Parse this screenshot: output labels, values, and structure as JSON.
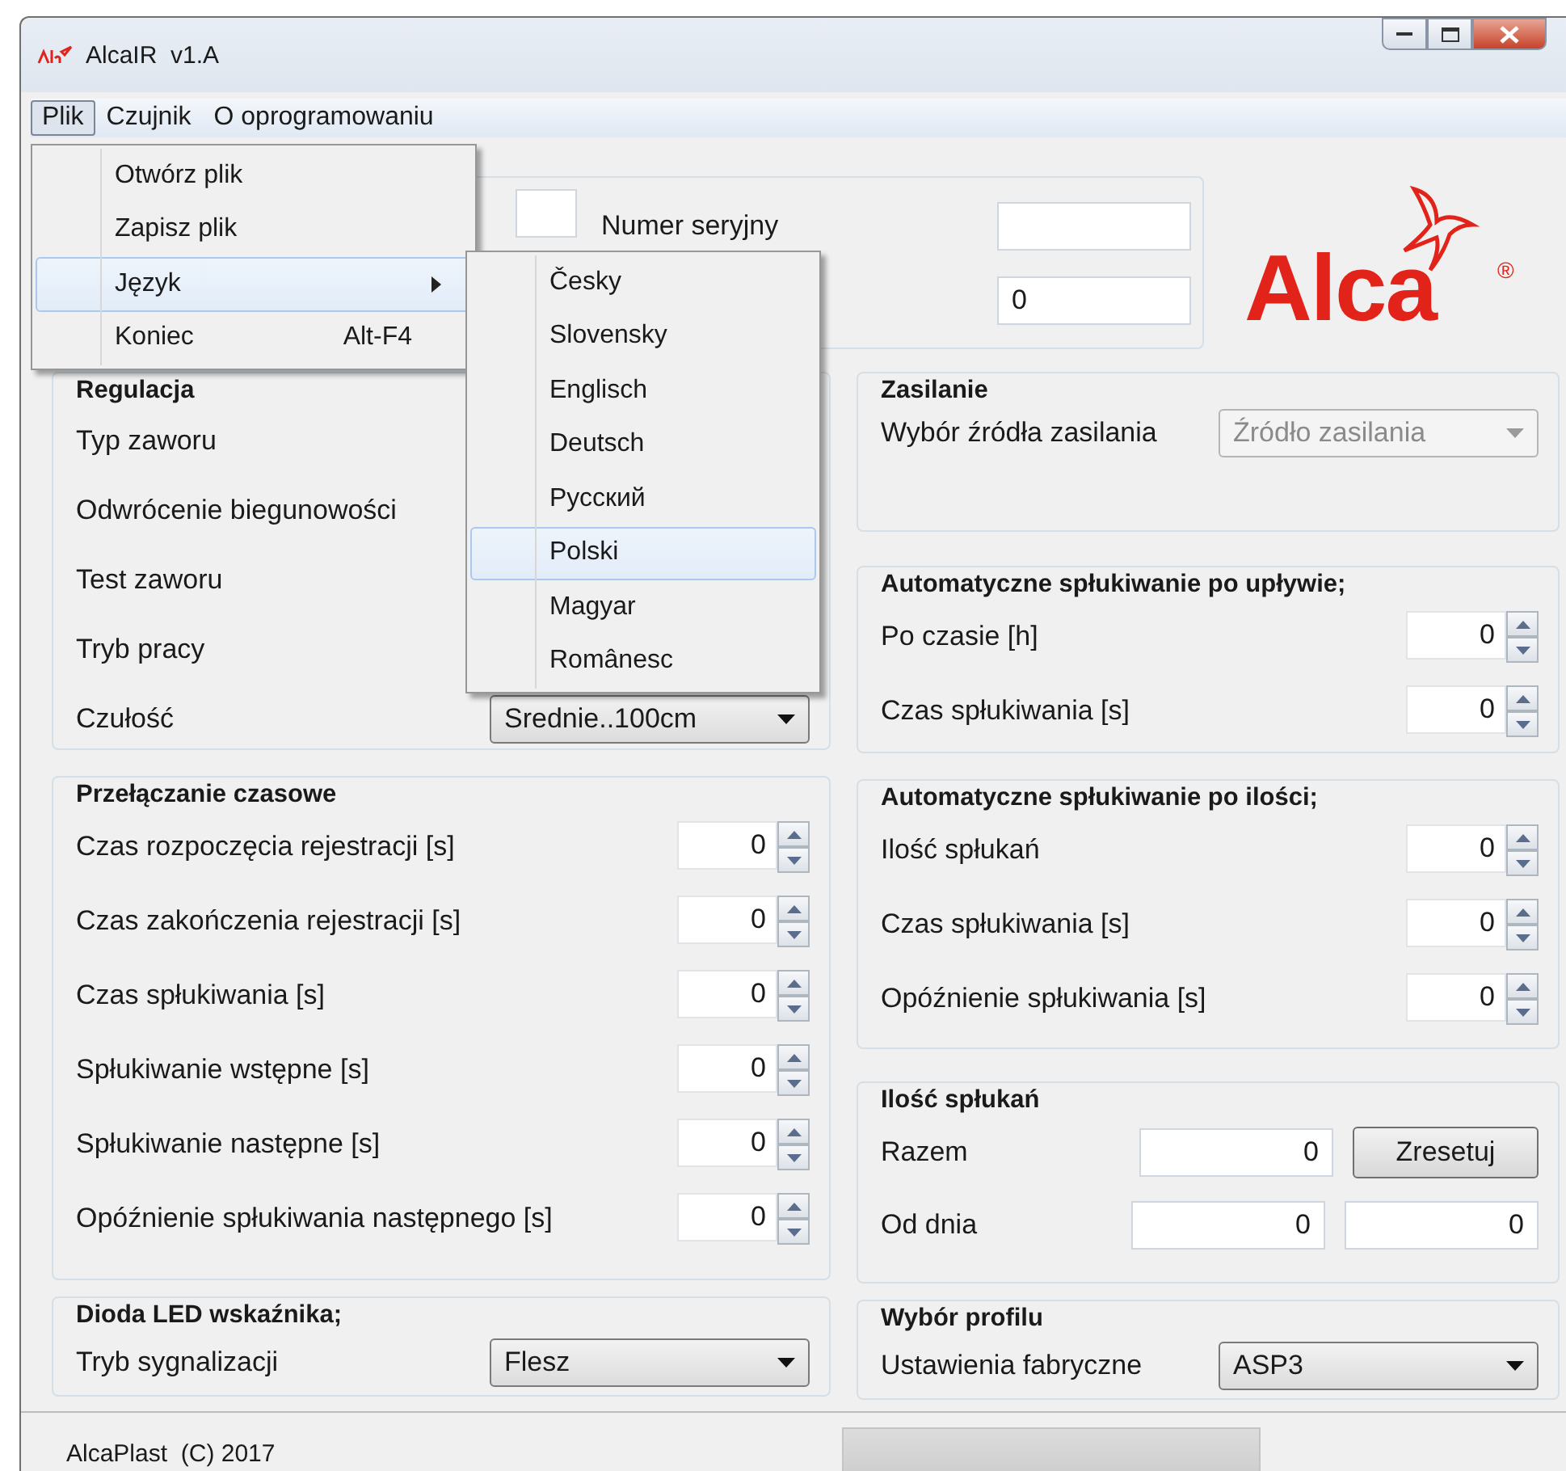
{
  "window": {
    "title": "AlcaIR  v1.A"
  },
  "menu_bar": [
    {
      "label": "Plik",
      "selected": true
    },
    {
      "label": "Czujnik",
      "selected": false
    },
    {
      "label": "O oprogramowaniu",
      "selected": false
    }
  ],
  "file_menu": [
    {
      "label": "Otwórz plik",
      "selected": false
    },
    {
      "label": "Zapisz plik",
      "selected": false
    },
    {
      "label": "Język",
      "submenu": true,
      "selected": true
    },
    {
      "label": "Koniec",
      "shortcut": "Alt-F4",
      "selected": false
    }
  ],
  "language_menu": [
    {
      "label": "Česky",
      "selected": false
    },
    {
      "label": "Slovensky",
      "selected": false
    },
    {
      "label": "Englisch",
      "selected": false
    },
    {
      "label": "Deutsch",
      "selected": false
    },
    {
      "label": "Русский",
      "selected": false
    },
    {
      "label": "Polski",
      "selected": true
    },
    {
      "label": "Magyar",
      "selected": false
    },
    {
      "label": "Românesc",
      "selected": false
    }
  ],
  "device": {
    "serial_label": "Numer seryjny",
    "counter_value": "0"
  },
  "logo": {
    "text": "Alca",
    "mark": "®"
  },
  "regulation": {
    "title": "Regulacja",
    "rows": [
      {
        "kind": "text",
        "label": "Typ zaworu"
      },
      {
        "kind": "text",
        "label": "Odwrócenie biegunowości"
      },
      {
        "kind": "text",
        "label": "Test zaworu"
      },
      {
        "kind": "text",
        "label": "Tryb pracy"
      },
      {
        "kind": "dropdown",
        "label": "Czułość",
        "value": "Srednie..100cm"
      }
    ]
  },
  "timing": {
    "title": "Przełączanie czasowe",
    "rows": [
      {
        "label": "Czas rozpoczęcia rejestracji [s]",
        "value": "0"
      },
      {
        "label": "Czas zakończenia rejestracji [s]",
        "value": "0"
      },
      {
        "label": "Czas spłukiwania [s]",
        "value": "0"
      },
      {
        "label": "Spłukiwanie wstępne [s]",
        "value": "0"
      },
      {
        "label": "Spłukiwanie następne [s]",
        "value": "0"
      },
      {
        "label": "Opóźnienie spłukiwania następnego [s]",
        "value": "0"
      }
    ]
  },
  "led": {
    "title": "Dioda LED wskaźnika;",
    "label": "Tryb sygnalizacji",
    "value": "Flesz"
  },
  "power": {
    "title": "Zasilanie",
    "label": "Wybór źródła zasilania",
    "value": "Źródło zasilania",
    "disabled": true
  },
  "auto_time": {
    "title": "Automatyczne spłukiwanie po upływie;",
    "rows": [
      {
        "label": "Po czasie [h]",
        "value": "0"
      },
      {
        "label": "Czas spłukiwania [s]",
        "value": "0"
      }
    ]
  },
  "auto_count": {
    "title": "Automatyczne spłukiwanie po ilości;",
    "rows": [
      {
        "label": "Ilość spłukań",
        "value": "0"
      },
      {
        "label": "Czas spłukiwania [s]",
        "value": "0"
      },
      {
        "label": "Opóźnienie spłukiwania [s]",
        "value": "0"
      }
    ]
  },
  "flush_count": {
    "title": "Ilość spłukań",
    "total_label": "Razem",
    "total_value": "0",
    "reset_button": "Zresetuj",
    "since_label": "Od dnia",
    "since_values": [
      "0",
      "0"
    ]
  },
  "profile": {
    "title": "Wybór profilu",
    "label": "Ustawienia fabryczne",
    "value": "ASP3"
  },
  "status_bar": {
    "text": "AlcaPlast  (C) 2017"
  }
}
